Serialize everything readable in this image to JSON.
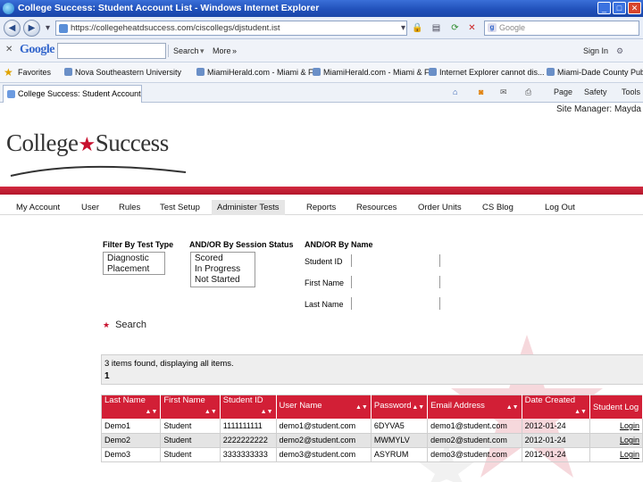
{
  "window": {
    "title": "College Success: Student Account List - Windows Internet Explorer"
  },
  "address": {
    "url": "https://collegeheatdsuccess.com/ciscollegs/djstudent.ist",
    "search_placeholder": "Google"
  },
  "google_toolbar": {
    "logo": "Google",
    "search_label": "Search",
    "more_label": "More",
    "signin_label": "Sign In"
  },
  "favorites": {
    "label": "Favorites",
    "items": [
      "Nova Southeastern University",
      "MiamiHerald.com - Miami & F...",
      "MiamiHerald.com - Miami & F...",
      "Internet Explorer cannot dis...",
      "Miami-Dade County Public ..."
    ]
  },
  "tab": {
    "label": "College Success: Student Account List",
    "page_label": "Page",
    "safety_label": "Safety",
    "tools_label": "Tools"
  },
  "page": {
    "site_manager": "Site Manager: Mayda",
    "logo_left": "College",
    "logo_right": "Success",
    "nav": [
      "My Account",
      "User",
      "Rules",
      "Test Setup",
      "Administer Tests",
      "Reports",
      "Resources",
      "Order Units",
      "CS Blog",
      "Log Out"
    ],
    "active_nav": "Administer Tests",
    "filter": {
      "test_type_label": "Filter By Test Type",
      "test_type_options": [
        "Diagnostic",
        "Placement"
      ],
      "session_label": "AND/OR By Session Status",
      "session_options": [
        "Scored",
        "In Progress",
        "Not Started"
      ],
      "name_label": "AND/OR By Name",
      "student_id_label": "Student ID",
      "first_name_label": "First Name",
      "last_name_label": "Last Name"
    },
    "search_label": "Search",
    "results_summary": "3 items found, displaying all items.",
    "current_page": "1",
    "table": {
      "headers": [
        "Last Name",
        "First Name",
        "Student ID",
        "User Name",
        "Password",
        "Email Address",
        "Date Created",
        "Student Log"
      ],
      "rows": [
        [
          "Demo1",
          "Student",
          "1111111111",
          "demo1@student.com",
          "6DYVA5",
          "demo1@student.com",
          "2012-01-24",
          "Login"
        ],
        [
          "Demo2",
          "Student",
          "2222222222",
          "demo2@student.com",
          "MWMYLV",
          "demo2@student.com",
          "2012-01-24",
          "Login"
        ],
        [
          "Demo3",
          "Student",
          "3333333333",
          "demo3@student.com",
          "ASYRUM",
          "demo3@student.com",
          "2012-01-24",
          "Login"
        ]
      ]
    }
  },
  "colors": {
    "brand_red": "#c8102e",
    "header_red": "#d21f36",
    "titlebar_blue": "#1f4fb8"
  }
}
